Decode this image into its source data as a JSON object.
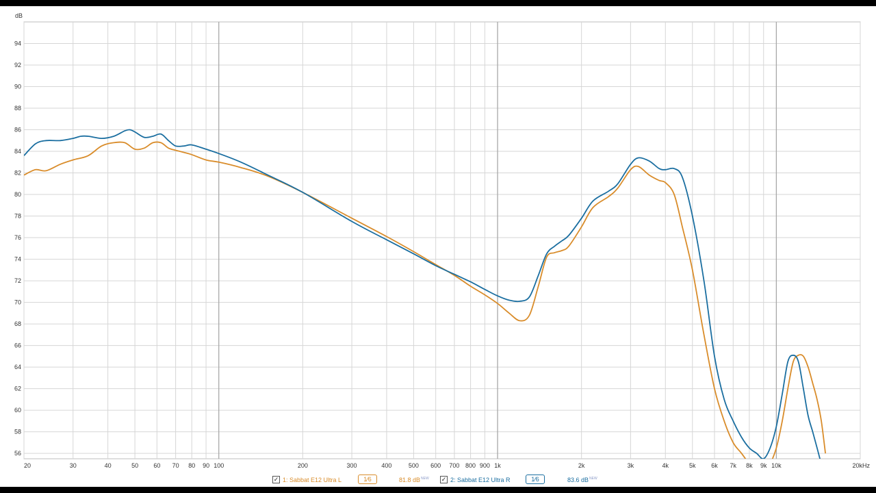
{
  "chart_data": {
    "type": "line",
    "title": "",
    "xlabel": "",
    "ylabel": "dB",
    "x_scale": "log",
    "xlim": [
      20,
      20000
    ],
    "ylim": [
      55.5,
      96
    ],
    "grid": true,
    "y_ticks": [
      "56",
      "58",
      "60",
      "62",
      "64",
      "66",
      "68",
      "70",
      "72",
      "74",
      "76",
      "78",
      "80",
      "82",
      "84",
      "86",
      "88",
      "90",
      "92",
      "94"
    ],
    "x_tick_labels": [
      "20",
      "30",
      "40",
      "50",
      "60",
      "70",
      "80",
      "90",
      "100",
      "200",
      "300",
      "400",
      "500",
      "600",
      "700",
      "800",
      "900",
      "1k",
      "2k",
      "3k",
      "4k",
      "5k",
      "6k",
      "7k",
      "8k",
      "9k",
      "10k",
      "20kHz"
    ],
    "series": [
      {
        "name": "1: Sabbat E12 Ultra L",
        "color": "#d98c2a",
        "x": [
          20,
          22,
          24,
          27,
          30,
          34,
          38,
          42,
          46,
          50,
          54,
          58,
          62,
          66,
          70,
          75,
          80,
          90,
          100,
          120,
          150,
          200,
          300,
          400,
          500,
          600,
          700,
          800,
          900,
          1000,
          1100,
          1200,
          1300,
          1400,
          1500,
          1600,
          1700,
          1800,
          2000,
          2200,
          2500,
          2700,
          3000,
          3200,
          3500,
          3800,
          4000,
          4300,
          4600,
          5000,
          5500,
          6000,
          6500,
          7000,
          7500,
          8000,
          8500,
          9000,
          9500,
          10000,
          10500,
          11000,
          11500,
          12000,
          12500,
          13000,
          13500,
          14000,
          14500,
          15000
        ],
        "y": [
          81.8,
          82.3,
          82.2,
          82.8,
          83.2,
          83.6,
          84.5,
          84.8,
          84.8,
          84.2,
          84.3,
          84.8,
          84.8,
          84.3,
          84.1,
          83.9,
          83.7,
          83.2,
          83,
          82.5,
          81.7,
          80.2,
          77.8,
          76.1,
          74.7,
          73.5,
          72.5,
          71.5,
          70.7,
          69.9,
          69.0,
          68.3,
          68.8,
          71.5,
          74.2,
          74.6,
          74.8,
          75.2,
          77.0,
          78.8,
          79.8,
          80.6,
          82.3,
          82.6,
          81.8,
          81.3,
          81.1,
          80,
          77,
          73,
          67,
          62,
          59,
          57,
          56,
          55,
          54,
          54,
          55,
          56.5,
          59,
          62,
          64.5,
          65.1,
          65,
          64,
          62.5,
          61,
          59,
          56
        ]
      },
      {
        "name": "2: Sabbat E12 Ultra R",
        "color": "#1a6ea0",
        "x": [
          20,
          22,
          24,
          27,
          30,
          32,
          34,
          38,
          42,
          46,
          48,
          50,
          54,
          58,
          62,
          66,
          70,
          75,
          80,
          90,
          100,
          120,
          150,
          200,
          300,
          400,
          500,
          600,
          700,
          800,
          900,
          1000,
          1100,
          1200,
          1300,
          1400,
          1500,
          1600,
          1700,
          1800,
          2000,
          2200,
          2500,
          2700,
          3000,
          3200,
          3500,
          3800,
          4000,
          4300,
          4600,
          5000,
          5500,
          6000,
          6500,
          7000,
          7500,
          8000,
          8500,
          9000,
          9500,
          10000,
          10500,
          11000,
          11500,
          12000,
          12500,
          13000,
          13500,
          14000,
          14500
        ],
        "y": [
          83.6,
          84.7,
          85,
          85,
          85.2,
          85.4,
          85.4,
          85.2,
          85.4,
          85.9,
          86,
          85.8,
          85.3,
          85.4,
          85.6,
          85.0,
          84.5,
          84.5,
          84.6,
          84.2,
          83.8,
          83,
          81.8,
          80.2,
          77.5,
          75.8,
          74.5,
          73.4,
          72.6,
          71.9,
          71.2,
          70.6,
          70.2,
          70.1,
          70.5,
          72.5,
          74.5,
          75.2,
          75.7,
          76.2,
          77.8,
          79.4,
          80.3,
          81,
          82.8,
          83.4,
          83.1,
          82.4,
          82.3,
          82.4,
          81.6,
          78,
          72,
          65,
          61,
          59,
          57.5,
          56.5,
          56,
          55.5,
          56.5,
          58.5,
          61.5,
          64.5,
          65.1,
          64.5,
          62,
          59.5,
          58,
          56.5,
          55
        ]
      }
    ],
    "legend": {
      "items": [
        {
          "label": "1: Sabbat E12 Ultra L",
          "smoothing": "1⁄6",
          "level": "81.8 dB",
          "level_tag": "NEW",
          "color": "#d98c2a",
          "checked": "✓"
        },
        {
          "label": "2: Sabbat E12 Ultra R",
          "smoothing": "1⁄6",
          "level": "83.6 dB",
          "level_tag": "NEW",
          "color": "#1a6ea0",
          "checked": "✓"
        }
      ]
    }
  }
}
